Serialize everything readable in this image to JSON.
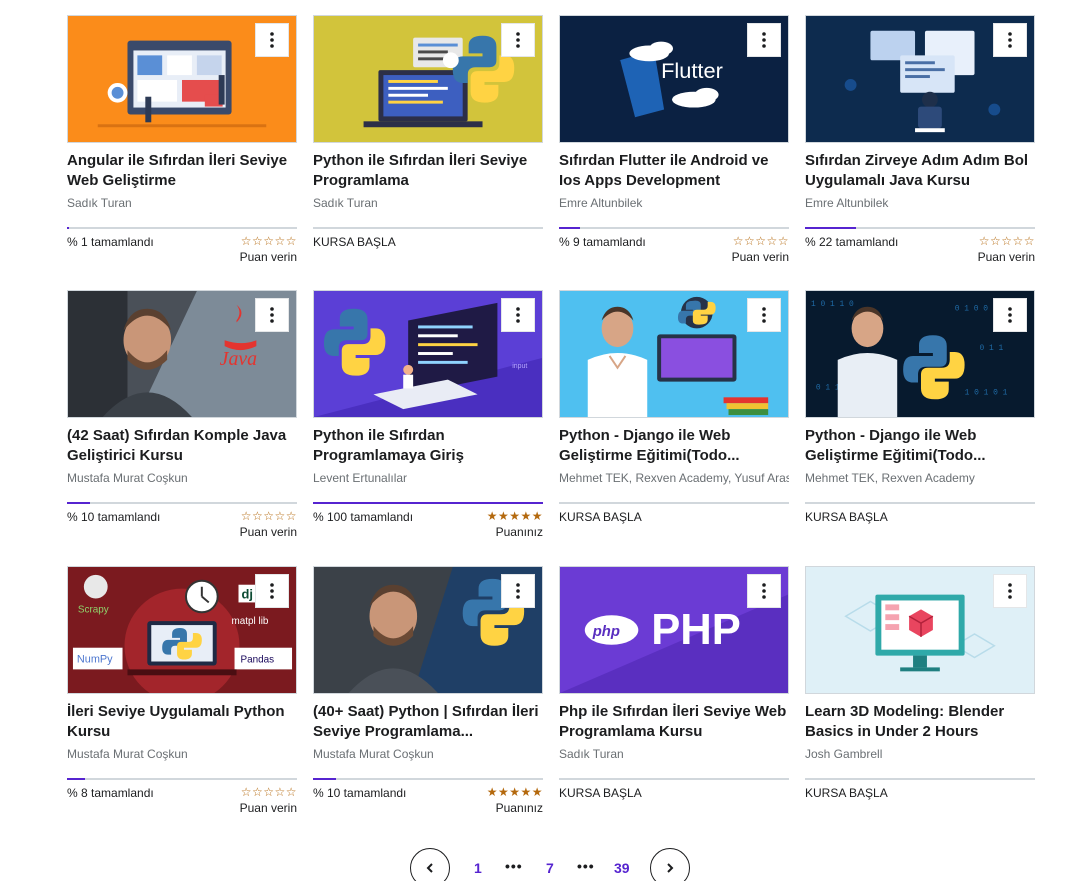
{
  "courses": [
    {
      "title": "Angular ile Sıfırdan İleri Seviye Web Geliştirme",
      "author": "Sadık Turan",
      "status": "% 1 tamamlandı",
      "progress": 0.01,
      "stars": "☆☆☆☆☆",
      "rating_label": "Puan verin",
      "thumb_icon": "angular-illustration"
    },
    {
      "title": "Python ile Sıfırdan İleri Seviye Programlama",
      "author": "Sadık Turan",
      "status": "KURSA BAŞLA",
      "progress": 0,
      "stars": "",
      "rating_label": "",
      "thumb_icon": "python-laptop-illustration"
    },
    {
      "title": "Sıfırdan Flutter ile Android ve Ios Apps Development",
      "author": "Emre Altunbilek",
      "status": "% 9 tamamlandı",
      "progress": 0.09,
      "stars": "☆☆☆☆☆",
      "rating_label": "Puan verin",
      "thumb_icon": "flutter-illustration",
      "thumb_text": "Flutter"
    },
    {
      "title": "Sıfırdan Zirveye Adım Adım Bol Uygulamalı Java Kursu",
      "author": "Emre Altunbilek",
      "status": "% 22 tamamlandı",
      "progress": 0.22,
      "stars": "☆☆☆☆☆",
      "rating_label": "Puan verin",
      "thumb_icon": "java-developer-illustration"
    },
    {
      "title": "(42 Saat) Sıfırdan Komple Java Geliştirici Kursu",
      "author": "Mustafa Murat Coşkun",
      "status": "% 10 tamamlandı",
      "progress": 0.1,
      "stars": "☆☆☆☆☆",
      "rating_label": "Puan verin",
      "thumb_icon": "java-instructor-photo",
      "thumb_text": "Java"
    },
    {
      "title": "Python ile Sıfırdan Programlamaya Giriş",
      "author": "Levent Ertunalılar",
      "status": "% 100 tamamlandı",
      "progress": 1.0,
      "stars": "★★★★★",
      "rating_label": "Puanınız",
      "thumb_icon": "python-isometric-illustration",
      "thumb_text": "input"
    },
    {
      "title": "Python - Django ile Web Geliştirme Eğitimi(Todo...",
      "author": "Mehmet TEK, Rexven Academy, Yusuf Aras",
      "status": "KURSA BAŞLA",
      "progress": 0,
      "stars": "",
      "rating_label": "",
      "thumb_icon": "python-django-instructor-photo"
    },
    {
      "title": "Python - Django ile Web Geliştirme Eğitimi(Todo...",
      "author": "Mehmet TEK, Rexven Academy",
      "status": "KURSA BAŞLA",
      "progress": 0,
      "stars": "",
      "rating_label": "",
      "thumb_icon": "python-django-binary-photo"
    },
    {
      "title": "İleri Seviye Uygulamalı Python Kursu",
      "author": "Mustafa Murat Coşkun",
      "status": "% 8 tamamlandı",
      "progress": 0.08,
      "stars": "☆☆☆☆☆",
      "rating_label": "Puan verin",
      "thumb_icon": "python-libraries-illustration",
      "thumb_labels": [
        "Scrapy",
        "dj",
        "matpl   lib",
        "NumPy",
        "Pandas"
      ]
    },
    {
      "title": "(40+ Saat) Python | Sıfırdan İleri Seviye Programlama...",
      "author": "Mustafa Murat Coşkun",
      "status": "% 10 tamamlandı",
      "progress": 0.1,
      "stars": "★★★★★",
      "rating_label": "Puanınız",
      "thumb_icon": "python-instructor-photo"
    },
    {
      "title": "Php ile Sıfırdan İleri Seviye Web Programlama Kursu",
      "author": "Sadık Turan",
      "status": "KURSA BAŞLA",
      "progress": 0,
      "stars": "",
      "rating_label": "",
      "thumb_icon": "php-illustration",
      "thumb_text": "PHP",
      "thumb_logo": "php"
    },
    {
      "title": "Learn 3D Modeling: Blender Basics in Under 2 Hours",
      "author": "Josh Gambrell",
      "status": "KURSA BAŞLA",
      "progress": 0,
      "stars": "",
      "rating_label": "",
      "thumb_icon": "blender-monitor-illustration"
    }
  ],
  "pagination": {
    "prev_icon": "chevron-left-icon",
    "first": "1",
    "dots1": "•••",
    "current": "7",
    "dots2": "•••",
    "last": "39",
    "next_icon": "chevron-right-icon"
  },
  "colors": {
    "accent": "#5624d0",
    "star": "#b4690e",
    "text": "#1c1d1f",
    "muted": "#6a6f73"
  }
}
